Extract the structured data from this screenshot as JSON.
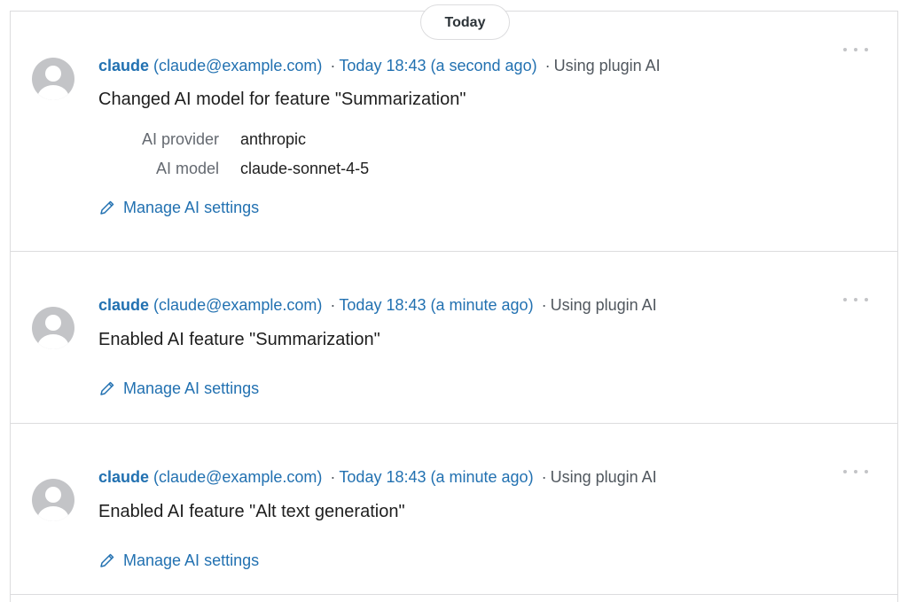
{
  "day_badge": "Today",
  "entries": [
    {
      "user_name": "claude",
      "user_email": "(claude@example.com)",
      "separator": "·",
      "time": "Today 18:43 (a second ago)",
      "initiator": "Using plugin AI",
      "message": "Changed AI model for feature \"Summarization\"",
      "details": [
        {
          "label": "AI provider",
          "value": "anthropic"
        },
        {
          "label": "AI model",
          "value": "claude-sonnet-4-5"
        }
      ],
      "action_label": "Manage AI settings"
    },
    {
      "user_name": "claude",
      "user_email": "(claude@example.com)",
      "separator": "·",
      "time": "Today 18:43 (a minute ago)",
      "initiator": "Using plugin AI",
      "message": "Enabled AI feature \"Summarization\"",
      "action_label": "Manage AI settings"
    },
    {
      "user_name": "claude",
      "user_email": "(claude@example.com)",
      "separator": "·",
      "time": "Today 18:43 (a minute ago)",
      "initiator": "Using plugin AI",
      "message": "Enabled AI feature \"Alt text generation\"",
      "action_label": "Manage AI settings"
    }
  ],
  "icons": {
    "avatar": "default-avatar-icon",
    "action": "pencil-icon",
    "more": "more-actions-icon"
  },
  "colors": {
    "link": "#2271b1",
    "text": "#1e1e1e",
    "muted": "#50575e",
    "border": "#dcdcde"
  }
}
